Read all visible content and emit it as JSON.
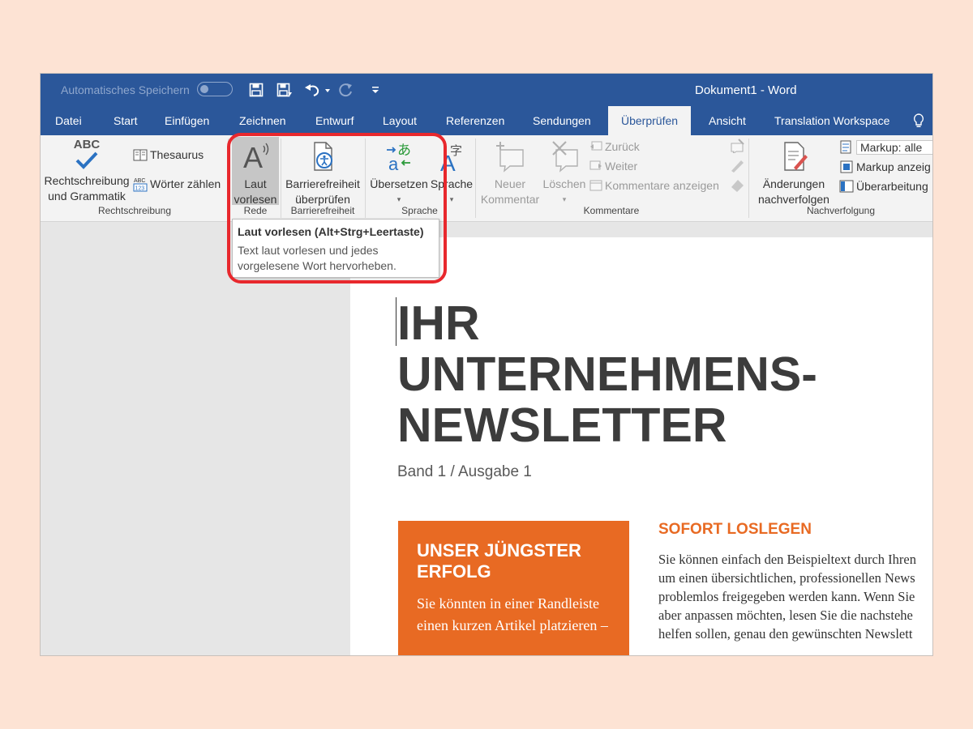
{
  "titlebar": {
    "autosave_label": "Automatisches Speichern",
    "doc_title": "Dokument1  -  Word",
    "icons": [
      "save-icon",
      "save-as-icon",
      "undo-icon",
      "redo-icon",
      "customize-qat-icon"
    ]
  },
  "tabs": [
    {
      "label": "Datei"
    },
    {
      "label": "Start"
    },
    {
      "label": "Einfügen"
    },
    {
      "label": "Zeichnen"
    },
    {
      "label": "Entwurf"
    },
    {
      "label": "Layout"
    },
    {
      "label": "Referenzen"
    },
    {
      "label": "Sendungen"
    },
    {
      "label": "Überprüfen",
      "active": true
    },
    {
      "label": "Ansicht"
    },
    {
      "label": "Translation Workspace"
    }
  ],
  "ribbon": {
    "rechtschreibung": {
      "abc": "ABC",
      "spell_line1": "Rechtschreibung",
      "spell_line2": "und Grammatik",
      "thesaurus": "Thesaurus",
      "word_count": "Wörter zählen",
      "group": "Rechtschreibung"
    },
    "rede": {
      "read_aloud_line1": "Laut",
      "read_aloud_line2": "vorlesen",
      "group": "Rede"
    },
    "barrierefreiheit": {
      "check_line1": "Barrierefreiheit",
      "check_line2": "überprüfen",
      "group": "Barrierefreiheit"
    },
    "sprache": {
      "translate": "Übersetzen",
      "language": "Sprache",
      "group": "Sprache"
    },
    "kommentare": {
      "new_line1": "Neuer",
      "new_line2": "Kommentar",
      "delete": "Löschen",
      "back": "Zurück",
      "next": "Weiter",
      "show": "Kommentare anzeigen",
      "group": "Kommentare"
    },
    "nachverfolgung": {
      "track_line1": "Änderungen",
      "track_line2": "nachverfolgen",
      "markup": "Markup: alle",
      "markup_show": "Markup anzeig",
      "review_pane": "Überarbeitung",
      "group": "Nachverfolgung"
    }
  },
  "tooltip": {
    "title": "Laut vorlesen (Alt+Strg+Leertaste)",
    "description": "Text laut vorlesen und jedes vorgelesene Wort hervorheben."
  },
  "document": {
    "headline": [
      "IHR",
      "UNTERNEHMENS-",
      "NEWSLETTER"
    ],
    "subtitle": "Band 1 / Ausgabe 1",
    "sidebar_title": [
      "UNSER JÜNGSTER",
      "ERFOLG"
    ],
    "sidebar_text": "Sie könnten in einer Randleiste einen kurzen Artikel platzieren –",
    "section_title": "SOFORT LOSLEGEN",
    "body_lines": [
      "Sie können einfach den Beispieltext durch Ihren",
      "um einen übersichtlichen, professionellen News",
      "problemlos freigegeben werden kann. Wenn Sie",
      "aber anpassen möchten, lesen Sie die nachstehe",
      "helfen sollen, genau den gewünschten Newslett"
    ]
  },
  "colors": {
    "word_blue": "#2b579a",
    "accent_orange": "#e86a23",
    "highlight_red": "#e8282d",
    "background": "#fde3d4"
  }
}
